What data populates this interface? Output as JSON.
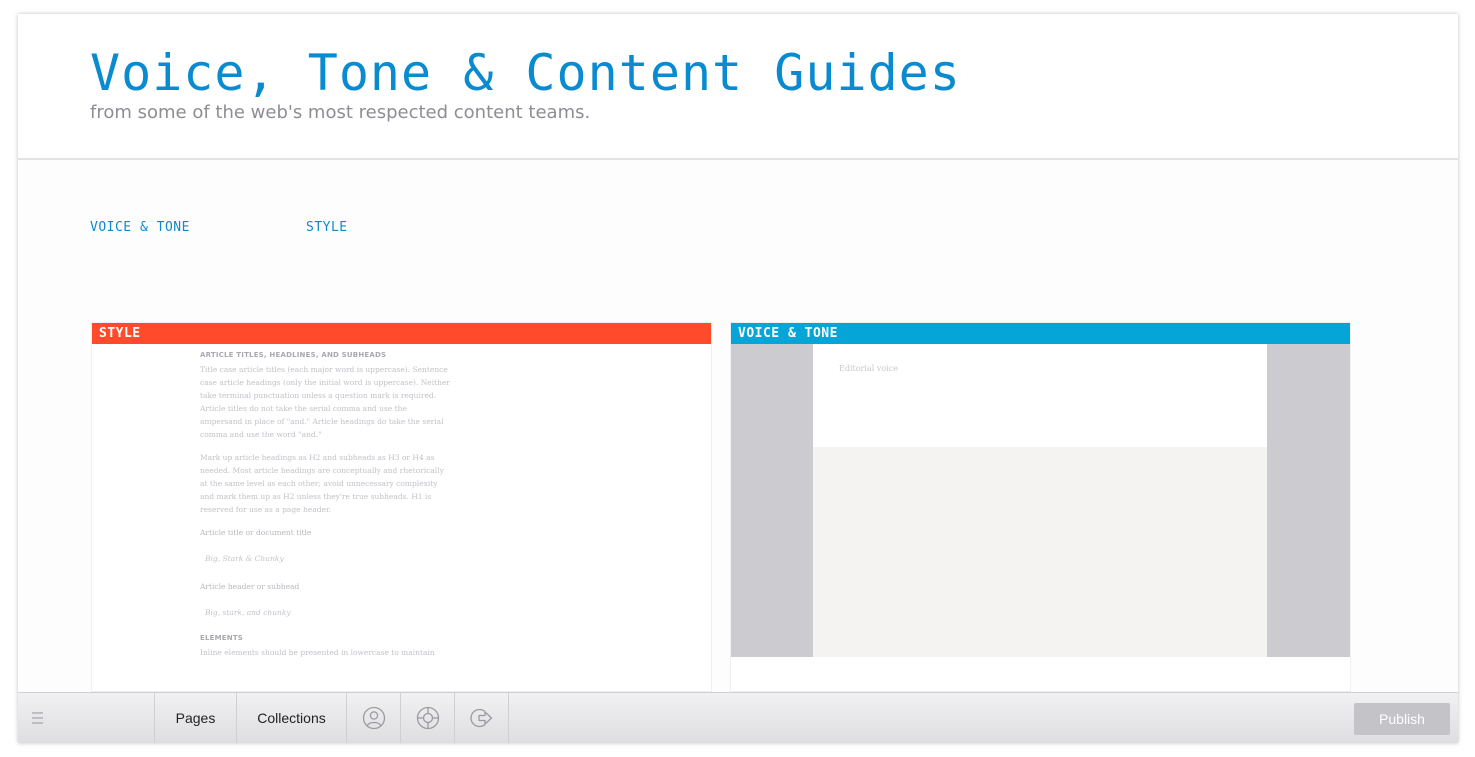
{
  "header": {
    "title": "Voice, Tone & Content Guides",
    "subtitle": "from some of the web's most respected content teams."
  },
  "nav": {
    "items": [
      {
        "label": "VOICE & TONE"
      },
      {
        "label": "STYLE"
      }
    ]
  },
  "cards": {
    "style": {
      "label": "STYLE",
      "heading1": "ARTICLE TITLES, HEADLINES, AND SUBHEADS",
      "paragraph1": "Title case article titles (each major word is uppercase). Sentence case article headings (only the initial word is uppercase). Neither take terminal punctuation unless a question mark is required. Article titles do not take the serial comma and use the ampersand in place of \"and.\" Article headings do take the serial comma and use the word \"and.\"",
      "paragraph2": "Mark up article headings as H2 and subheads as H3 or H4 as needed. Most article headings are conceptually and rhetorically at the same level as each other; avoid unnecessary complexity and mark them up as H2 unless they're true subheads. H1 is reserved for use as a page header.",
      "label_title": "Article title or document title",
      "example_title": "Big, Stark & Chunky",
      "label_header": "Article header or subhead",
      "example_header": "Big, stark, and chunky",
      "heading2": "ELEMENTS",
      "paragraph3": "Inline elements should be presented in lowercase to maintain"
    },
    "voice": {
      "label": "VOICE & TONE",
      "text": "Editorial voice"
    }
  },
  "toolbar": {
    "pages_label": "Pages",
    "collections_label": "Collections",
    "publish_label": "Publish",
    "icons": [
      "menu-icon",
      "user-icon",
      "help-icon",
      "logout-icon"
    ]
  },
  "colors": {
    "accent_blue": "#0a8bd0",
    "style_red": "#ff4b2b",
    "voice_blue": "#06a5d8"
  }
}
